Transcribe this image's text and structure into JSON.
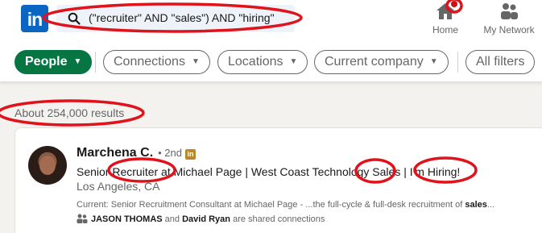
{
  "header": {
    "logo_text": "in",
    "search": {
      "value": "(\"recruiter\" AND \"sales\") AND \"hiring\""
    },
    "nav": [
      {
        "label": "Home",
        "icon": "home-icon"
      },
      {
        "label": "My Network",
        "icon": "network-icon"
      }
    ]
  },
  "filters": {
    "people": "People",
    "connections": "Connections",
    "locations": "Locations",
    "company": "Current company",
    "all_filters": "All filters"
  },
  "results": {
    "count_text": "About 254,000 results"
  },
  "result_card": {
    "name": "Marchena C.",
    "degree": "• 2nd",
    "badge": "in",
    "headline": "Senior Recruiter at Michael Page | West Coast Technology Sales | I'm Hiring!",
    "location": "Los Angeles, CA",
    "current_prefix": "Current: Senior Recruitment Consultant at Michael Page - ...the full-cycle & full-desk recruitment of ",
    "current_bold": "sales",
    "current_suffix": "...",
    "shared_name1": "JASON THOMAS",
    "shared_and": " and ",
    "shared_name2": "David Ryan",
    "shared_suffix": " are shared connections"
  },
  "colors": {
    "brand_blue": "#0a66c2",
    "people_green": "#057642",
    "annotation_red": "#e0121b"
  }
}
